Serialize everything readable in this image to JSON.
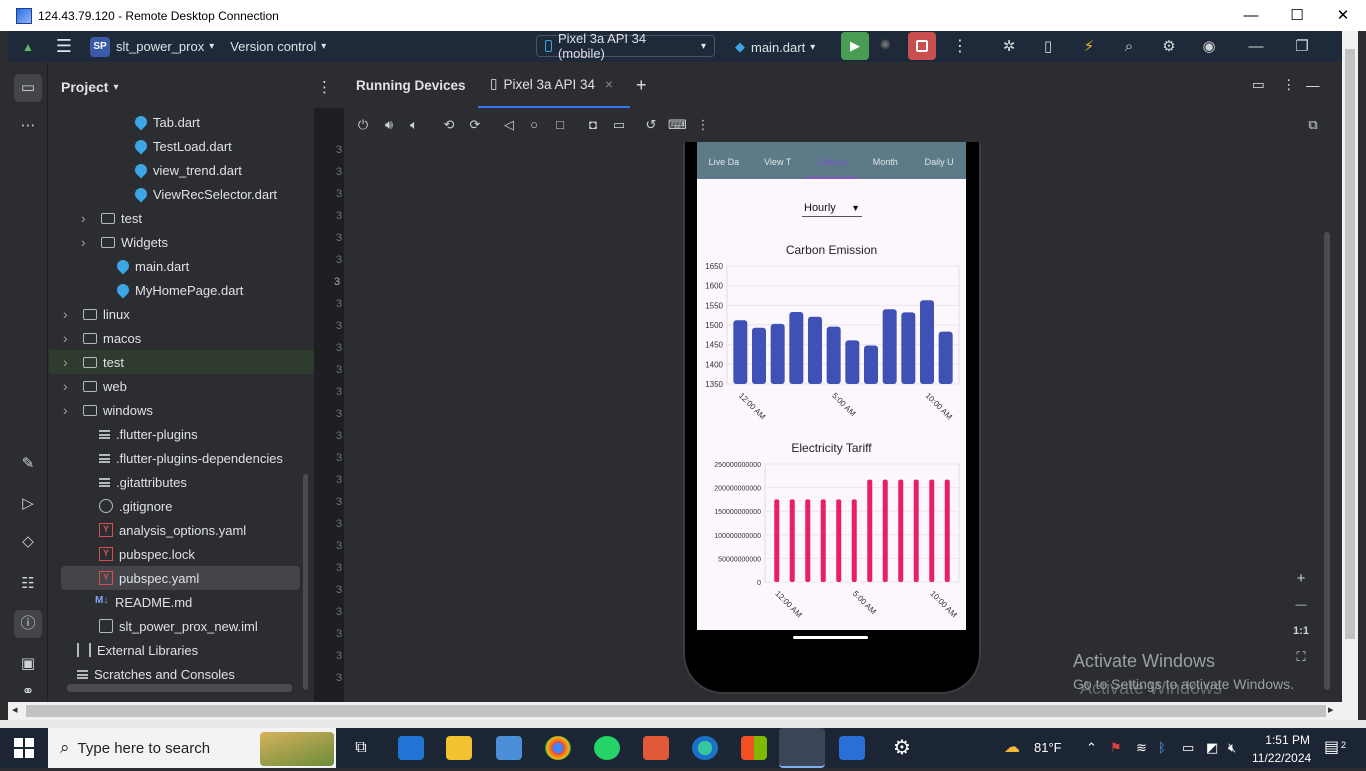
{
  "rdp": {
    "title": "124.43.79.120 - Remote Desktop Connection",
    "min": "—",
    "max": "☐",
    "close": "✕"
  },
  "ide": {
    "project_badge": "SP",
    "project_name": "slt_power_prox",
    "vcs": "Version control",
    "device": "Pixel 3a API 34 (mobile)",
    "config": "main.dart",
    "chevron": "⌄"
  },
  "project_panel": {
    "title": "Project",
    "rows": [
      {
        "label": "Tab.dart",
        "icon": "dart-file-icon"
      },
      {
        "label": "TestLoad.dart",
        "icon": "dart-file-icon"
      },
      {
        "label": "view_trend.dart",
        "icon": "dart-file-icon"
      },
      {
        "label": "ViewRecSelector.dart",
        "icon": "dart-file-icon"
      },
      {
        "label": "test",
        "icon": "folder-icon"
      },
      {
        "label": "Widgets",
        "icon": "folder-icon"
      },
      {
        "label": "main.dart",
        "icon": "dart-file-icon"
      },
      {
        "label": "MyHomePage.dart",
        "icon": "dart-file-icon"
      },
      {
        "label": "linux",
        "icon": "folder-icon"
      },
      {
        "label": "macos",
        "icon": "folder-icon"
      },
      {
        "label": "test",
        "icon": "folder-icon"
      },
      {
        "label": "web",
        "icon": "folder-icon"
      },
      {
        "label": "windows",
        "icon": "folder-icon"
      },
      {
        "label": ".flutter-plugins",
        "icon": "text-file-icon"
      },
      {
        "label": ".flutter-plugins-dependencies",
        "icon": "text-file-icon"
      },
      {
        "label": ".gitattributes",
        "icon": "text-file-icon"
      },
      {
        "label": ".gitignore",
        "icon": "ignore-file-icon"
      },
      {
        "label": "analysis_options.yaml",
        "icon": "yaml-file-icon"
      },
      {
        "label": "pubspec.lock",
        "icon": "yaml-file-icon"
      },
      {
        "label": "pubspec.yaml",
        "icon": "yaml-file-icon"
      },
      {
        "label": "README.md",
        "icon": "markdown-file-icon"
      },
      {
        "label": "slt_power_prox_new.iml",
        "icon": "iml-file-icon"
      },
      {
        "label": "External Libraries",
        "icon": "library-icon"
      },
      {
        "label": "Scratches and Consoles",
        "icon": "scratches-icon"
      }
    ],
    "md_mark": "M↓",
    "yaml_mark": "Y"
  },
  "gutter": [
    "3",
    "3",
    "3",
    "3",
    "3",
    "3",
    "3",
    "3",
    "3",
    "3",
    "3",
    "3",
    "3",
    "3",
    "3",
    "3",
    "3",
    "3",
    "3",
    "3",
    "3",
    "3",
    "3",
    "3",
    "3"
  ],
  "running_devices": {
    "title": "Running Devices",
    "tab": "Pixel 3a API 34",
    "tab_close": "×",
    "add": "+"
  },
  "app": {
    "tabs": [
      "Live Da",
      "View T",
      "Calcula",
      "Month",
      "Daily U"
    ],
    "dropdown_value": "Hourly",
    "chart1_title": "Carbon Emission",
    "chart2_title": "Electricity Tariff"
  },
  "chart_data": [
    {
      "type": "bar",
      "title": "Carbon Emission",
      "ylim": [
        1350,
        1650
      ],
      "yticks": [
        "1650",
        "1600",
        "1550",
        "1500",
        "1450",
        "1400",
        "1350"
      ],
      "xticks": [
        "12:00 AM",
        "5:00 AM",
        "10:00 AM"
      ],
      "values": [
        1512,
        1493,
        1503,
        1533,
        1521,
        1496,
        1461,
        1448,
        1540,
        1532,
        1563,
        1483
      ],
      "color": "#3f51b5"
    },
    {
      "type": "bar",
      "title": "Electricity Tariff",
      "ylim": [
        0,
        250000000000
      ],
      "yticks": [
        "250000000000",
        "200000000000",
        "150000000000",
        "100000000000",
        "50000000000",
        "0"
      ],
      "xticks": [
        "12:00 AM",
        "5:00 AM",
        "10:00 AM"
      ],
      "values": [
        175000000000,
        175000000000,
        175000000000,
        175000000000,
        175000000000,
        175000000000,
        217000000000,
        217000000000,
        217000000000,
        217000000000,
        217000000000,
        217000000000
      ],
      "color": "#e91e63"
    }
  ],
  "zoom": {
    "plus": "+",
    "minus": "—",
    "fit": "1:1"
  },
  "watermark": {
    "line1": "Activate Windows",
    "line2": "Go to Settings to activate Windows.",
    "line3": "Activate Windows"
  },
  "taskbar": {
    "search_placeholder": "Type here to search",
    "weather": "81°F",
    "time": "1:51 PM",
    "date": "11/22/2024",
    "notif_count": "2"
  }
}
